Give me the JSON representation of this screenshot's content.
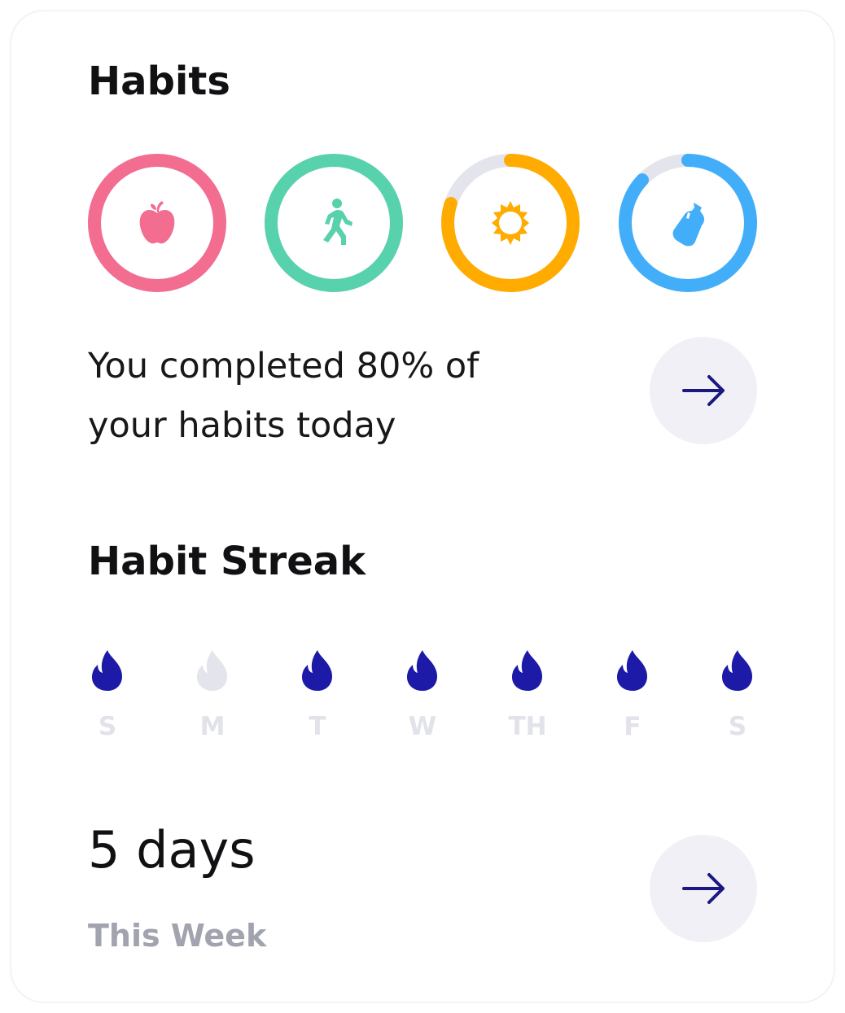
{
  "habits": {
    "title": "Habits",
    "rings": [
      {
        "name": "apple-icon",
        "color": "#f26d90",
        "track": "#e3e4ec",
        "progress": 1.0
      },
      {
        "name": "walking-icon",
        "color": "#58d1ad",
        "track": "#e3e4ec",
        "progress": 1.0
      },
      {
        "name": "sun-icon",
        "color": "#ffab00",
        "track": "#e3e4ec",
        "progress": 0.8
      },
      {
        "name": "water-bottle-icon",
        "color": "#42aef9",
        "track": "#e3e4ec",
        "progress": 0.87
      }
    ],
    "summary_text": "You completed 80% of your habits today",
    "next_icon": "arrow-right-icon"
  },
  "streak": {
    "title": "Habit Streak",
    "days": [
      {
        "label": "S",
        "active": true
      },
      {
        "label": "M",
        "active": false
      },
      {
        "label": "T",
        "active": true
      },
      {
        "label": "W",
        "active": true
      },
      {
        "label": "TH",
        "active": true
      },
      {
        "label": "F",
        "active": true
      },
      {
        "label": "S",
        "active": true
      }
    ],
    "flame_active_color": "#1c1aa6",
    "flame_inactive_color": "#e3e4ec",
    "count_text": "5 days",
    "period_text": "This Week",
    "next_icon": "arrow-right-icon"
  },
  "colors": {
    "arrow": "#1b1880",
    "button_bg": "#f1f0f7"
  }
}
